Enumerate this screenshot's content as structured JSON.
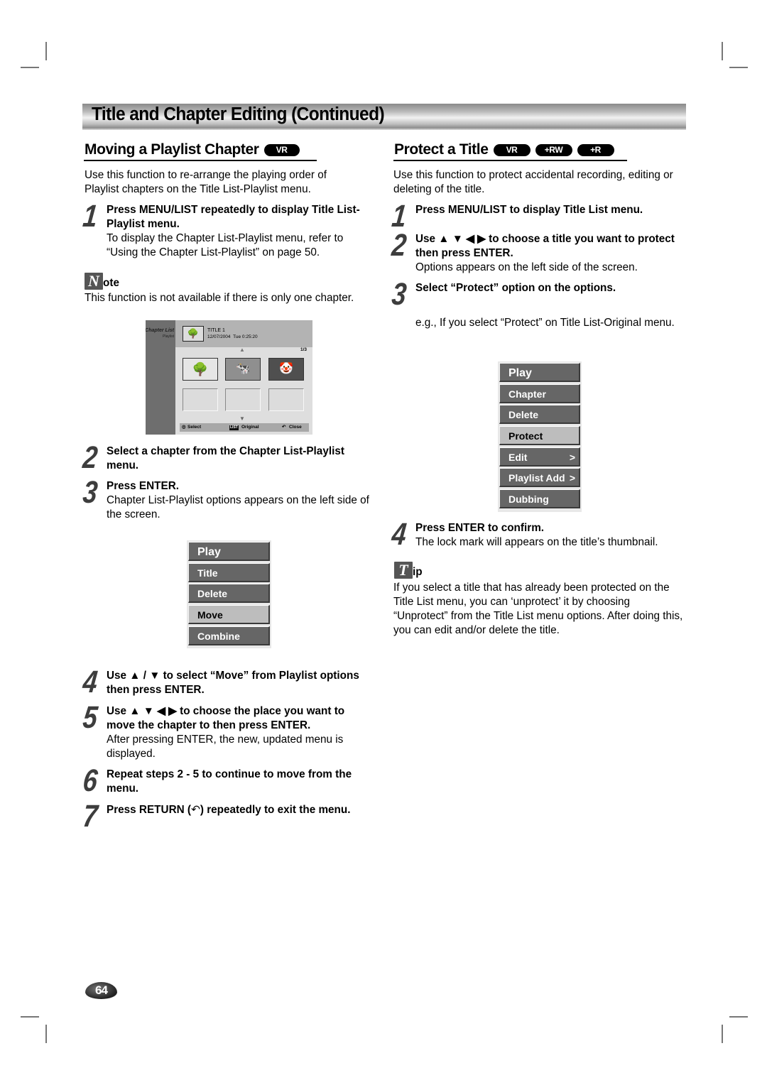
{
  "page": {
    "banner_title": "Title and Chapter Editing (Continued)",
    "page_number": "64"
  },
  "left": {
    "heading": "Moving a Playlist Chapter",
    "badges": [
      "VR"
    ],
    "intro": "Use this function to re-arrange the playing order of Playlist chapters on the Title List-Playlist menu.",
    "steps": [
      {
        "num": "1",
        "bold": "Press MENU/LIST repeatedly to display Title List-Playlist menu.",
        "text": "To display the Chapter List-Playlist menu, refer to “Using the Chapter List-Playlist” on page 50."
      },
      {
        "num": "2",
        "bold": "Select a chapter from the Chapter List-Playlist menu.",
        "text": ""
      },
      {
        "num": "3",
        "bold": "Press ENTER.",
        "text": "Chapter List-Playlist options appears on the left side of the screen."
      },
      {
        "num": "4",
        "bold": "Use ▲ / ▼ to select “Move” from Playlist options then press ENTER.",
        "text": ""
      },
      {
        "num": "5",
        "bold": "Use ▲ ▼ ◀ ▶ to choose the place you want to move the chapter to then press ENTER.",
        "text": "After pressing ENTER, the new, updated menu is displayed."
      },
      {
        "num": "6",
        "bold": "Repeat steps 2 - 5 to continue to move from the menu.",
        "text": ""
      },
      {
        "num": "7",
        "bold_a": "Press RETURN (",
        "bold_b": ") repeatedly to exit the menu.",
        "text": ""
      }
    ],
    "note": {
      "icon_letter": "N",
      "label": "ote",
      "text": "This function is not available if there is only one chapter."
    },
    "screen": {
      "side_title": "Chapter List",
      "side_subtitle": "Playlist",
      "title": "TITLE 1",
      "date": "12/07/2004",
      "day_time": "Tue 0:25:20",
      "page_indicator": "1/3",
      "footer": {
        "select": "Select",
        "list_key": "LIST",
        "original": "Original",
        "close": "Close"
      }
    },
    "menu_items": [
      {
        "label": "Play",
        "selected": false
      },
      {
        "label": "Title",
        "selected": false
      },
      {
        "label": "Delete",
        "selected": false
      },
      {
        "label": "Move",
        "selected": true
      },
      {
        "label": "Combine",
        "selected": false
      }
    ]
  },
  "right": {
    "heading": "Protect a Title",
    "badges": [
      "VR",
      "+RW",
      "+R"
    ],
    "intro": "Use this function to protect accidental recording, editing or deleting of the title.",
    "steps": [
      {
        "num": "1",
        "bold": "Press MENU/LIST to display Title List menu.",
        "text": ""
      },
      {
        "num": "2",
        "bold": "Use ▲ ▼ ◀ ▶ to choose a title you want to protect then press ENTER.",
        "text": "Options appears on the left side of the screen."
      },
      {
        "num": "3",
        "bold": "Select “Protect” option on the options.",
        "text": ""
      },
      {
        "num": "4",
        "bold": "Press ENTER to confirm.",
        "text": "The lock mark will appears on the title’s thumbnail."
      }
    ],
    "example": "e.g., If you select “Protect” on Title List-Original menu.",
    "menu_items": [
      {
        "label": "Play",
        "selected": false,
        "submenu": false
      },
      {
        "label": "Chapter",
        "selected": false,
        "submenu": false
      },
      {
        "label": "Delete",
        "selected": false,
        "submenu": false
      },
      {
        "label": "Protect",
        "selected": true,
        "submenu": false
      },
      {
        "label": "Edit",
        "selected": false,
        "submenu": true
      },
      {
        "label": "Playlist Add",
        "selected": false,
        "submenu": true
      },
      {
        "label": "Dubbing",
        "selected": false,
        "submenu": false
      }
    ],
    "tip": {
      "icon_letter": "T",
      "label": "ip",
      "text": "If you select a title that has already been protected on the Title List menu, you can ‘unprotect’ it by choosing “Unprotect” from the Title List menu options. After doing this, you can edit and/or delete the title."
    }
  }
}
